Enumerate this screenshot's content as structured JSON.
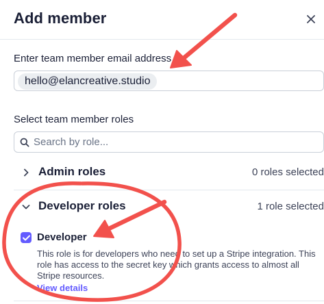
{
  "dialog": {
    "title": "Add member"
  },
  "email": {
    "label": "Enter team member email address",
    "value": "hello@elancreative.studio"
  },
  "roles": {
    "label": "Select team member roles",
    "search_placeholder": "Search by role...",
    "groups": [
      {
        "title": "Admin roles",
        "count": "0 roles selected",
        "expanded": false
      },
      {
        "title": "Developer roles",
        "count": "1 role selected",
        "expanded": true
      }
    ],
    "developer": {
      "name": "Developer",
      "checked": true,
      "description": "This role is for developers who need to set up a Stripe integration. This role has access to the secret key which grants access to almost all Stripe resources.",
      "link": "View details"
    }
  },
  "colors": {
    "accent": "#635bff",
    "annotation": "#f2514c",
    "text": "#1a1f36",
    "muted": "#697386"
  },
  "icons": {
    "close": "close-icon",
    "search": "search-icon",
    "collapsed": "chevron-right-icon",
    "expanded": "chevron-down-icon",
    "checkbox": "checkmark-icon"
  }
}
